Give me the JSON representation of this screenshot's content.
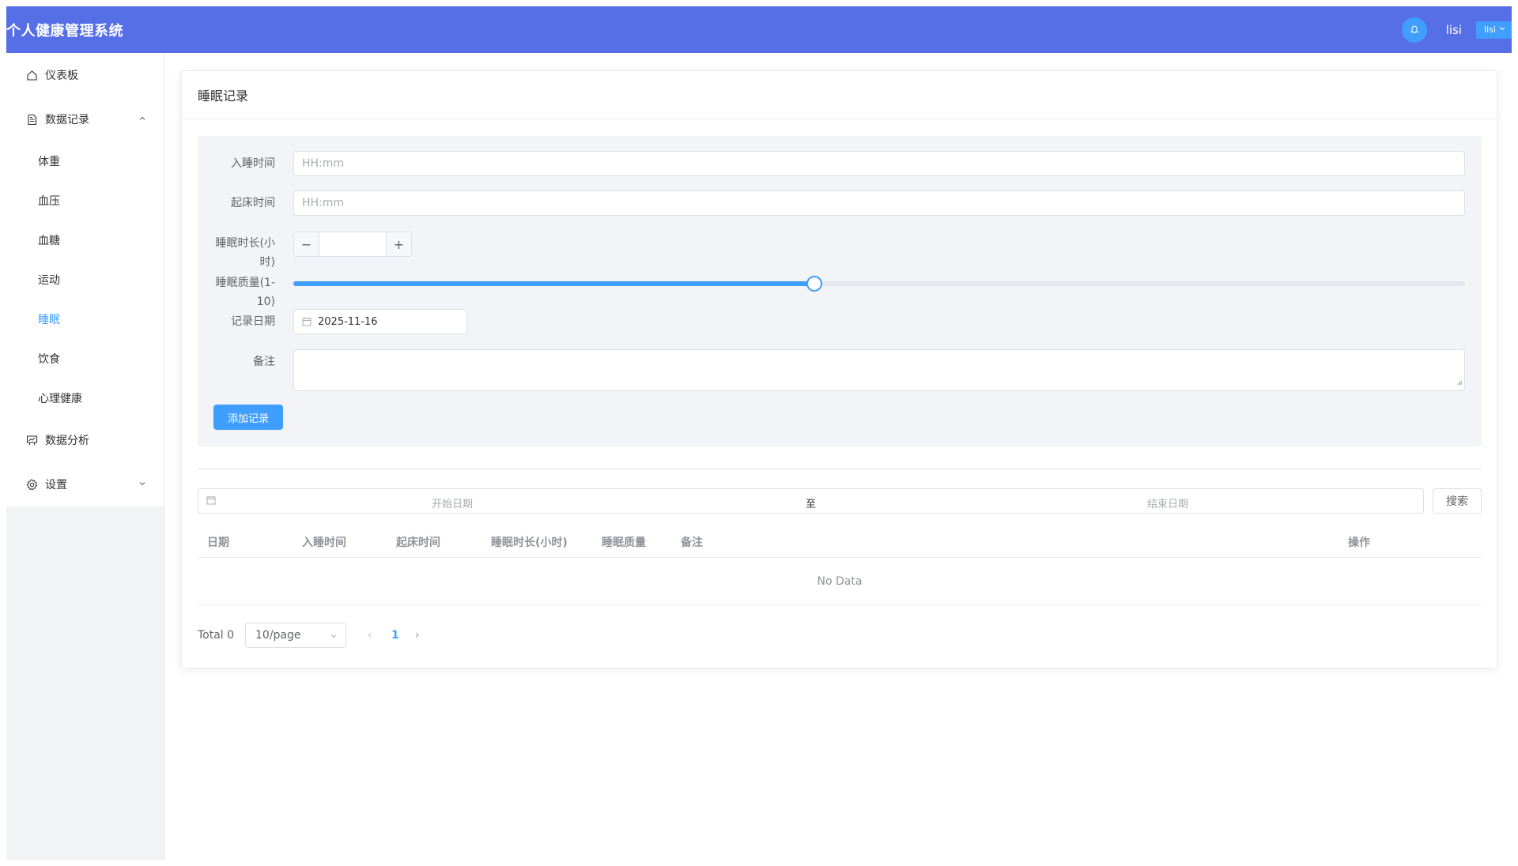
{
  "header": {
    "title": "个人健康管理系统",
    "username": "lisi",
    "user_dropdown": "lisi"
  },
  "sidebar": {
    "items": [
      {
        "label": "仪表板",
        "icon": "home-icon"
      },
      {
        "label": "数据记录",
        "icon": "document-icon",
        "expanded": true,
        "children": [
          "体重",
          "血压",
          "血糖",
          "运动",
          "睡眠",
          "饮食",
          "心理健康"
        ],
        "active_child": "睡眠"
      },
      {
        "label": "数据分析",
        "icon": "chart-board-icon"
      },
      {
        "label": "设置",
        "icon": "gear-icon",
        "expanded": false
      }
    ]
  },
  "card": {
    "title": "睡眠记录"
  },
  "form": {
    "sleep_time_label": "入睡时间",
    "sleep_time_placeholder": "HH:mm",
    "wake_time_label": "起床时间",
    "wake_time_placeholder": "HH:mm",
    "duration_label_1": "睡眠时长(小",
    "duration_label_2": "时)",
    "duration_minus": "−",
    "duration_plus": "+",
    "quality_label_1": "睡眠质量(1-",
    "quality_label_2": "10)",
    "quality_value": 5,
    "quality_max": 10,
    "quality_min": 1,
    "date_label": "记录日期",
    "date_value": "2025-11-16",
    "note_label": "备注",
    "submit_label": "添加记录"
  },
  "filter": {
    "start_placeholder": "开始日期",
    "separator": "至",
    "end_placeholder": "结束日期",
    "search_label": "搜索"
  },
  "table": {
    "columns": [
      "日期",
      "入睡时间",
      "起床时间",
      "睡眠时长(小时)",
      "睡眠质量",
      "备注",
      "操作"
    ],
    "empty_text": "No Data"
  },
  "pagination": {
    "total_text": "Total 0",
    "page_size": "10/page",
    "current_page": "1",
    "prev": "‹",
    "next": "›"
  },
  "colors": {
    "header_bg": "#566ee6",
    "primary": "#409eff"
  }
}
